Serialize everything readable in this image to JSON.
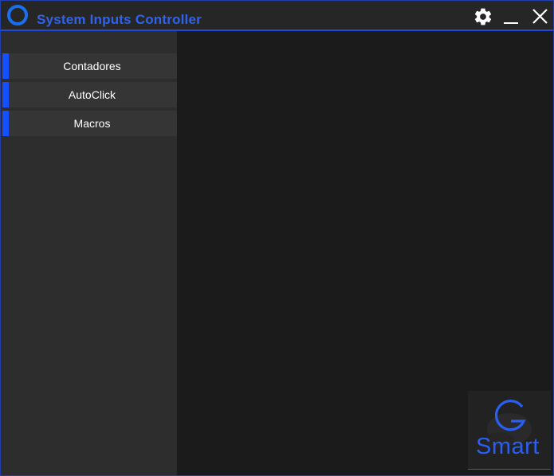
{
  "window": {
    "title": "System Inputs Controller",
    "accent_color": "#1f48d8",
    "title_color": "#2f63ee",
    "icons": {
      "app": "ring-icon",
      "settings": "gear-icon",
      "minimize": "minimize-icon",
      "close": "close-icon"
    }
  },
  "sidebar": {
    "items": [
      {
        "label": "Contadores"
      },
      {
        "label": "AutoClick"
      },
      {
        "label": "Macros"
      }
    ],
    "indicator_color": "#1450ff"
  },
  "logo": {
    "text": "Smart",
    "letter": "G",
    "color": "#2b5ff2"
  }
}
